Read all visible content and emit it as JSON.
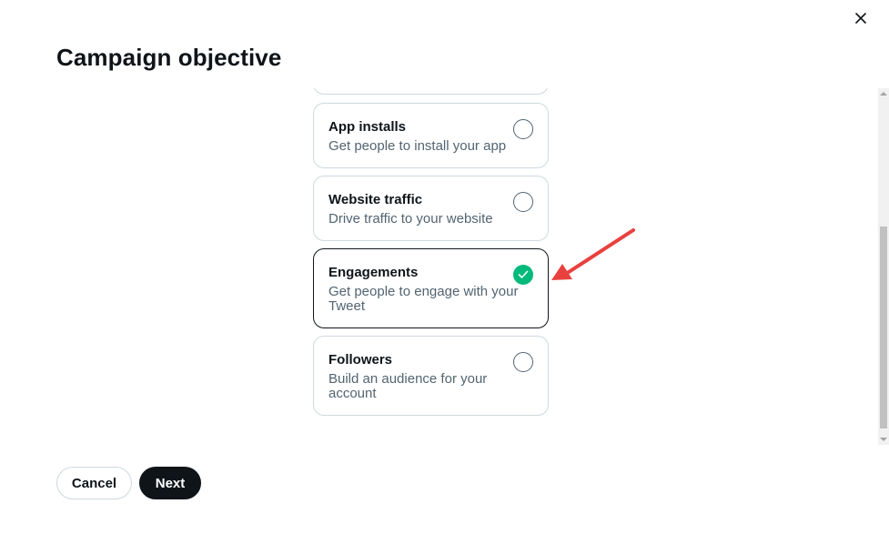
{
  "dialog": {
    "title": "Campaign objective",
    "close_icon": "close-icon"
  },
  "objectives": [
    {
      "title": "",
      "description": "",
      "selected": false
    },
    {
      "title": "App installs",
      "description": "Get people to install your app",
      "selected": false
    },
    {
      "title": "Website traffic",
      "description": "Drive traffic to your website",
      "selected": false
    },
    {
      "title": "Engagements",
      "description": "Get people to engage with your Tweet",
      "selected": true
    },
    {
      "title": "Followers",
      "description": "Build an audience for your account",
      "selected": false
    }
  ],
  "footer": {
    "cancel_label": "Cancel",
    "next_label": "Next"
  },
  "colors": {
    "selected_check": "#00ba7c",
    "annotation_arrow": "#e8413e",
    "primary_button": "#0f1419"
  }
}
